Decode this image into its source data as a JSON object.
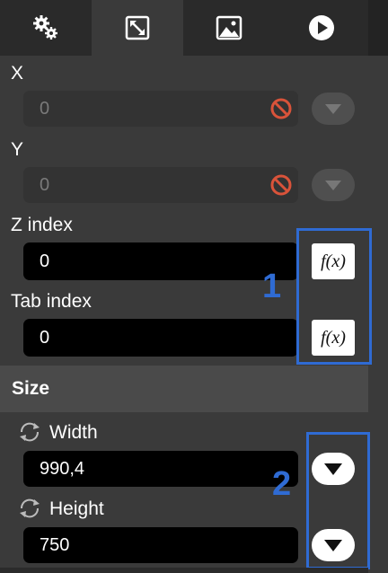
{
  "tabs": [
    {
      "icon": "gears-icon",
      "active": false
    },
    {
      "icon": "resize-arrows-icon",
      "active": true
    },
    {
      "icon": "image-icon",
      "active": false
    },
    {
      "icon": "play-icon",
      "active": false
    }
  ],
  "fields": {
    "x": {
      "label": "X",
      "value": "0"
    },
    "y": {
      "label": "Y",
      "value": "0"
    },
    "z_index": {
      "label": "Z index",
      "value": "0",
      "fx": "f(x)"
    },
    "tab_index": {
      "label": "Tab index",
      "value": "0",
      "fx": "f(x)"
    }
  },
  "size_section": {
    "title": "Size",
    "width": {
      "label": "Width",
      "value": "990,4"
    },
    "height": {
      "label": "Height",
      "value": "750"
    }
  },
  "annotations": [
    "1",
    "2"
  ],
  "colors": {
    "accent": "#2f6bd3",
    "panel": "#3a3a3a",
    "tabbar": "#232323",
    "ban": "#d9533a"
  }
}
